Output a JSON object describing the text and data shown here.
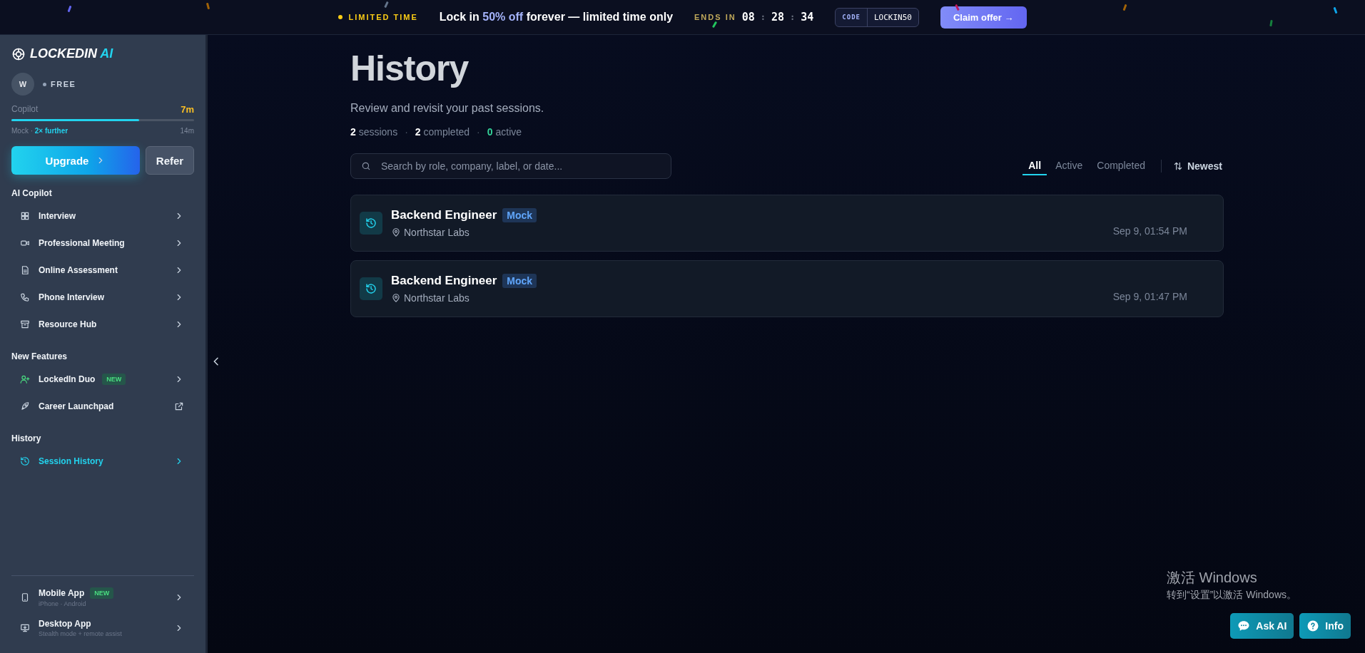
{
  "promo": {
    "tag": "LIMITED TIME",
    "message_start": "Lock in",
    "highlight": "50% off",
    "message_end": "forever — limited time only",
    "ends_label": "ENDS IN",
    "countdown": [
      "08",
      ":",
      "28",
      ":",
      "34"
    ],
    "code_label": "CODE",
    "code": "LOCKIN50",
    "cta": "Claim offer →"
  },
  "sidebar": {
    "brand": "LOCKEDIN",
    "brand_accent": "AI",
    "avatar": "W",
    "plan": "FREE",
    "usage": {
      "label": "Copilot",
      "value": "7m",
      "level": 0.7,
      "sub_label": "Mock ·",
      "sub_accent": "2× further",
      "sub_value": "14m"
    },
    "upgrade": "Upgrade",
    "refer": "Refer",
    "sections": [
      {
        "title": "AI Copilot",
        "items": [
          {
            "label": "Interview",
            "kind": "page",
            "selected": false
          },
          {
            "label": "Professional Meeting",
            "kind": "page",
            "selected": false
          },
          {
            "label": "Online Assessment",
            "kind": "page",
            "selected": false
          },
          {
            "label": "Phone Interview",
            "kind": "page",
            "selected": false
          },
          {
            "label": "Resource Hub",
            "kind": "page",
            "selected": false
          }
        ]
      },
      {
        "title": "New Features",
        "items": [
          {
            "label": "LockedIn Duo",
            "kind": "page",
            "selected": false,
            "badge": "NEW"
          },
          {
            "label": "Career Launchpad",
            "kind": "external",
            "selected": false
          }
        ]
      },
      {
        "title": "History",
        "items": [
          {
            "label": "Session History",
            "kind": "page",
            "selected": true
          }
        ]
      }
    ],
    "apps": [
      {
        "label": "Mobile App",
        "badge": "NEW",
        "sub": "iPhone · Android"
      },
      {
        "label": "Desktop App",
        "sub": "Stealth mode + remote assist"
      }
    ]
  },
  "page": {
    "title": "History",
    "subtitle": "Review and revisit your past sessions.",
    "stats": [
      {
        "count": "2",
        "label": "sessions",
        "kind": "plain"
      },
      {
        "count": "2",
        "label": "completed",
        "kind": "plain",
        "separator": "·"
      },
      {
        "count": "0",
        "label": "active",
        "kind": "accent",
        "separator": "·"
      }
    ],
    "search": {
      "placeholder": "Search by role, company, label, or date..."
    },
    "filters": [
      {
        "label": "All",
        "selected": true
      },
      {
        "label": "Active",
        "selected": false
      },
      {
        "label": "Completed",
        "selected": false
      }
    ],
    "sort": "Newest",
    "sessions": [
      {
        "title": "Backend Engineer",
        "tag": "Mock",
        "company": "Northstar Labs",
        "date": "Sep 9, 01:54 PM"
      },
      {
        "title": "Backend Engineer",
        "tag": "Mock",
        "company": "Northstar Labs",
        "date": "Sep 9, 01:47 PM"
      }
    ]
  },
  "os_notice": {
    "title": "激活 Windows",
    "text": "转到“设置”以激活 Windows。"
  },
  "floating": [
    {
      "label": "Ask AI",
      "kind": "chat"
    },
    {
      "label": "Info",
      "kind": "help"
    }
  ]
}
